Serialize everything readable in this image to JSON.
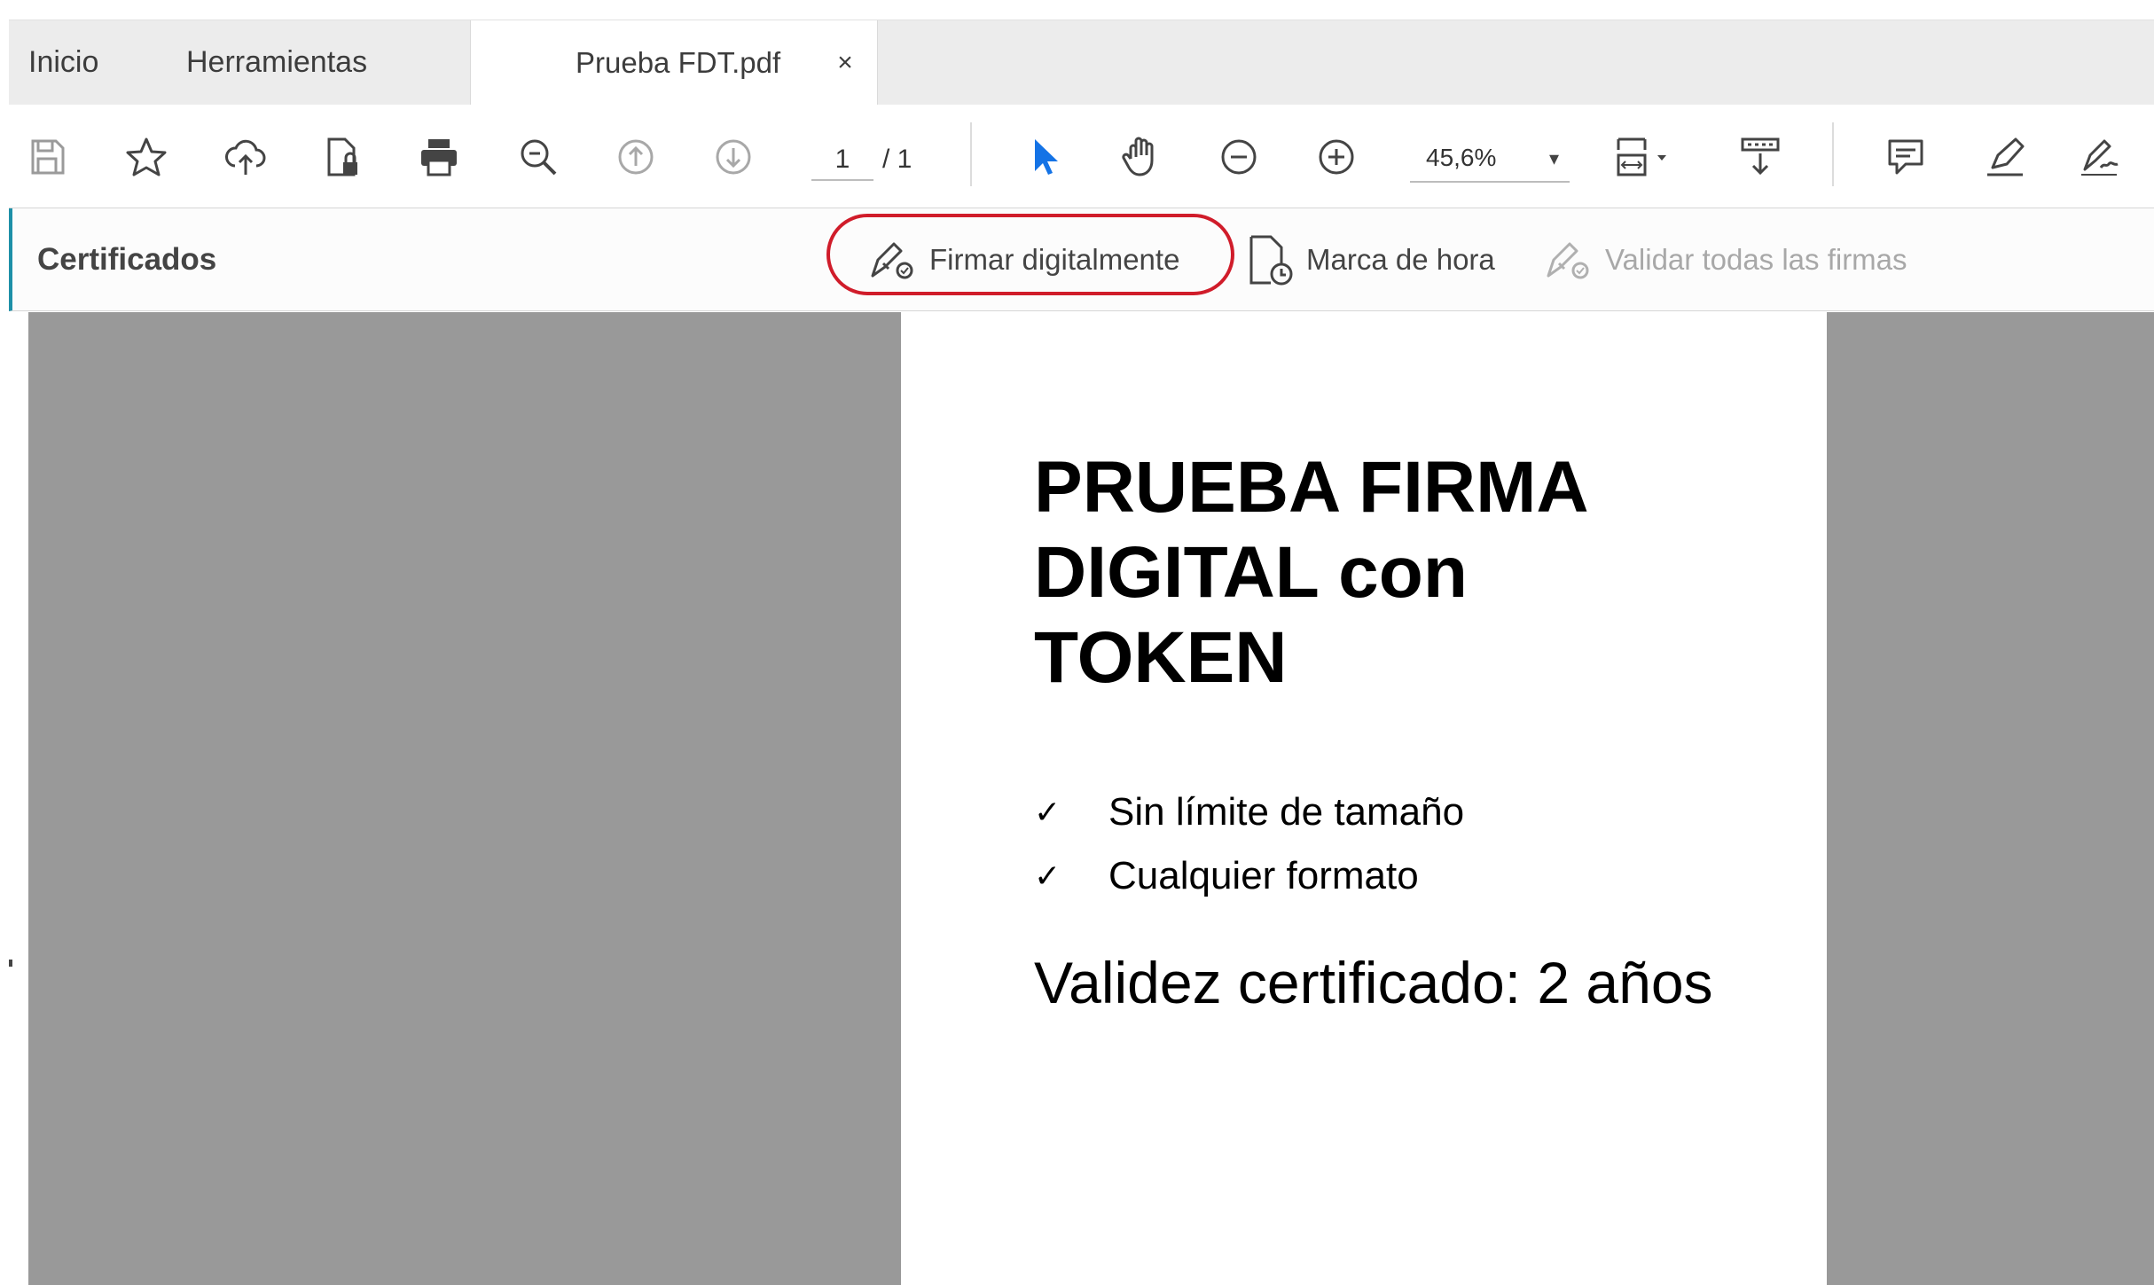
{
  "tabs": {
    "home_label": "Inicio",
    "tools_label": "Herramientas",
    "document_label": "Prueba FDT.pdf",
    "close_glyph": "×"
  },
  "toolbar": {
    "icons": [
      "save-icon",
      "star-icon",
      "upload-cloud-icon",
      "protect-file-icon",
      "print-icon",
      "zoom-search-icon",
      "page-up-icon",
      "page-down-icon",
      "select-arrow-icon",
      "hand-tool-icon",
      "zoom-out-icon",
      "zoom-in-icon",
      "fit-page-icon",
      "scroll-mode-icon",
      "comment-icon",
      "highlight-pen-icon",
      "sign-icon"
    ],
    "current_page": "1",
    "page_total": "/ 1",
    "zoom_value": "45,6%",
    "zoom_caret": "▾",
    "active_color": "#1473e6"
  },
  "cert_bar": {
    "title": "Certificados",
    "sign_label": "Firmar digitalmente",
    "timestamp_label": "Marca de hora",
    "validate_label": "Validar todas las firmas",
    "highlight_color": "#d01c2a",
    "accent_color": "#1e90a8"
  },
  "document": {
    "title_line1": "PRUEBA FIRMA",
    "title_line2": "DIGITAL con",
    "title_line3": "TOKEN",
    "check_glyph": "✓",
    "bullets": [
      "Sin límite de tamaño",
      "Cualquier formato"
    ],
    "validity": "Validez certificado: 2 años"
  }
}
